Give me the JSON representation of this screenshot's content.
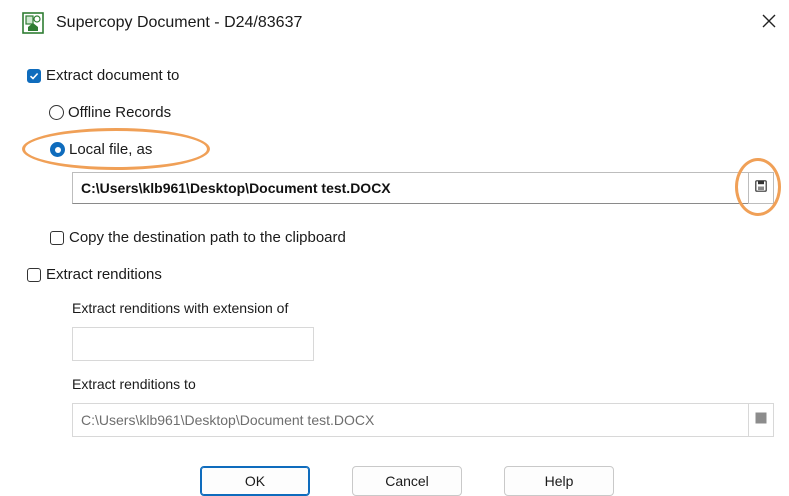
{
  "window": {
    "title": "Supercopy Document - D24/83637",
    "close_glyph": "✕"
  },
  "extract_document": {
    "label": "Extract document to",
    "checked": true,
    "options": [
      {
        "label": "Offline Records",
        "selected": false
      },
      {
        "label": "Local file, as",
        "selected": true
      }
    ],
    "local_path": "C:\\Users\\klb961\\Desktop\\Document test.DOCX",
    "copy_path_label": "Copy the destination path to the clipboard",
    "copy_path_checked": false
  },
  "extract_renditions": {
    "label": "Extract renditions",
    "checked": false,
    "extension_label": "Extract renditions with extension of",
    "extension_value": "",
    "to_label": "Extract renditions to",
    "to_path": "C:\\Users\\klb961\\Desktop\\Document test.DOCX"
  },
  "buttons": {
    "ok": "OK",
    "cancel": "Cancel",
    "help": "Help"
  },
  "colors": {
    "accent": "#0f6cbd",
    "highlight": "#f0a057"
  },
  "icons": {
    "app": "document-copy-icon",
    "browse": "save-disk-icon",
    "close": "close-icon"
  }
}
